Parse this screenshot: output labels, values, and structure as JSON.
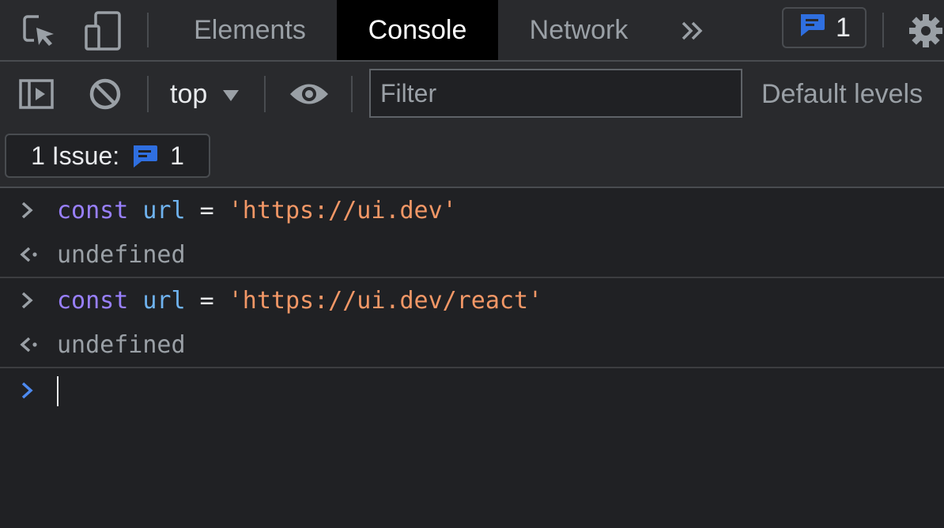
{
  "toolbar_tabs": {
    "elements": "Elements",
    "console": "Console",
    "network": "Network"
  },
  "issues_badge": {
    "count": "1"
  },
  "console_toolbar": {
    "context": "top",
    "filter_placeholder": "Filter",
    "levels": "Default levels"
  },
  "issues_bar": {
    "label": "1 Issue:",
    "count": "1"
  },
  "entries": [
    {
      "input": {
        "keyword": "const",
        "variable": "url",
        "operator": "=",
        "string": "'https://ui.dev'"
      },
      "result": "undefined"
    },
    {
      "input": {
        "keyword": "const",
        "variable": "url",
        "operator": "=",
        "string": "'https://ui.dev/react'"
      },
      "result": "undefined"
    }
  ],
  "colors": {
    "background": "#202124",
    "toolbar": "#292a2d",
    "keyword": "#9980ff",
    "variable": "#6fb3f0",
    "string": "#f29766",
    "issue_blue": "#2f6fe0"
  },
  "icons": {
    "inspect": "inspect-element-icon",
    "device": "device-toolbar-icon",
    "more_tabs": "double-chevron-icon",
    "issue": "message-icon",
    "settings": "gear-icon",
    "sidebar": "sidebar-toggle-icon",
    "clear": "clear-console-icon",
    "eye": "eye-icon",
    "prompt": "chevron-right-icon",
    "return": "return-arrow-icon"
  }
}
